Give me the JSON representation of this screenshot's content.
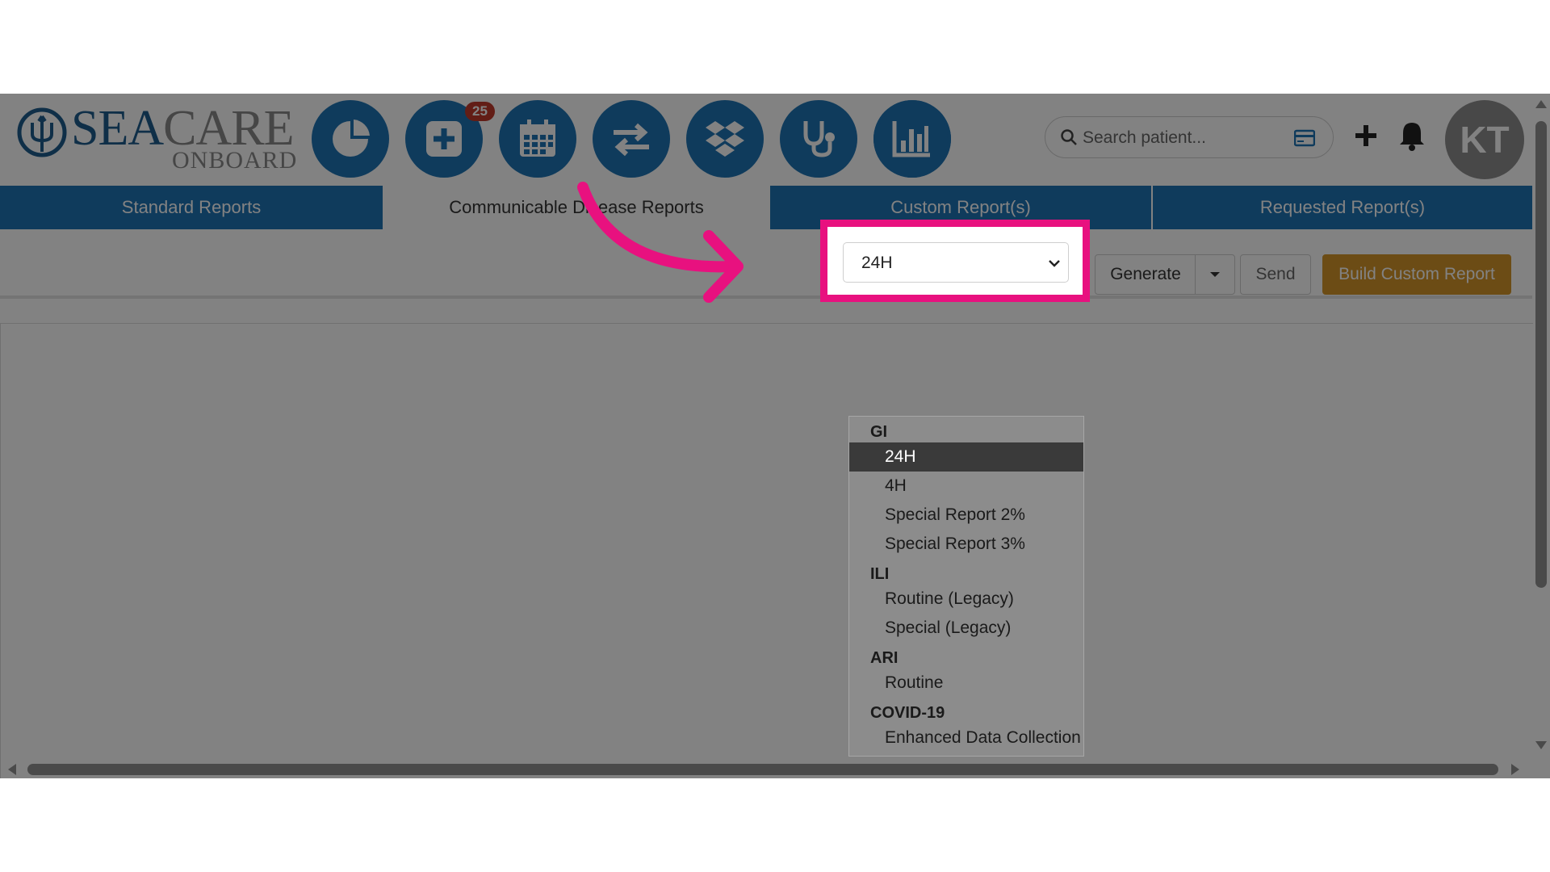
{
  "app": {
    "logo_word1_a": "SEA",
    "logo_word1_b": "CARE",
    "logo_word2": "ONBOARD"
  },
  "nav_icons": [
    {
      "name": "dashboard-pie-icon"
    },
    {
      "name": "medical-plus-icon",
      "badge": "25"
    },
    {
      "name": "calendar-icon"
    },
    {
      "name": "transfer-arrows-icon"
    },
    {
      "name": "dropbox-icon"
    },
    {
      "name": "stethoscope-icon"
    },
    {
      "name": "reports-chart-icon"
    }
  ],
  "search": {
    "placeholder": "Search patient..."
  },
  "user": {
    "initials": "KT"
  },
  "tabs": [
    {
      "label": "Standard Reports",
      "active": false
    },
    {
      "label": "Communicable Disease Reports",
      "active": true
    },
    {
      "label": "Custom Report(s)",
      "active": false
    },
    {
      "label": "Requested Report(s)",
      "active": false
    }
  ],
  "toolbar": {
    "selected_report": "24H",
    "generate_label": "Generate",
    "send_label": "Send",
    "build_label": "Build Custom Report"
  },
  "dropdown": {
    "groups": [
      {
        "label": "GI",
        "items": [
          "24H",
          "4H",
          "Special Report 2%",
          "Special Report 3%"
        ]
      },
      {
        "label": "ILI",
        "items": [
          "Routine (Legacy)",
          "Special (Legacy)"
        ]
      },
      {
        "label": "ARI",
        "items": [
          "Routine"
        ]
      },
      {
        "label": "COVID-19",
        "items": [
          "Enhanced Data Collection"
        ]
      }
    ],
    "selected": "24H"
  },
  "colors": {
    "brand_blue": "#1f74b5",
    "accent_gold": "#d4962a",
    "highlight_pink": "#e8117f",
    "badge_red": "#c0392b"
  }
}
